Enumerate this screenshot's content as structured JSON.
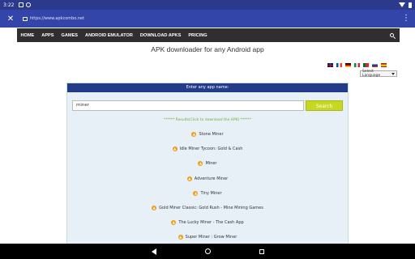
{
  "status": {
    "time": "3:22"
  },
  "browser": {
    "url": "https://www.apkcombo.net"
  },
  "nav": {
    "items": [
      "HOME",
      "APPS",
      "GAMES",
      "ANDROID EMULATOR",
      "DOWNLOAD APKS",
      "PRICING"
    ]
  },
  "headline": "APK downloader for any Android app",
  "language": {
    "selected": "Select Language"
  },
  "panel": {
    "header": "Enter any app name:",
    "search_value": "miner",
    "search_button": "Search",
    "results_note": "****** Results(Click to download the APK) ******",
    "results": [
      "Stone Miner",
      "Idle Miner Tycoon: Gold & Cash",
      "Miner",
      "Adventure Miner",
      "Tiny Miner",
      "Gold Miner Classic: Gold Rush - Mine Mining Games",
      "The Lucky Miner - The Cash App",
      "Super Miner : Grow Miner"
    ]
  },
  "colors": {
    "status_bar": "#2b3a8c",
    "browser_bar": "#3345a8",
    "navbar": "#2f2f2f",
    "panel_header": "#233c8a",
    "search_button": "#c6d821"
  }
}
